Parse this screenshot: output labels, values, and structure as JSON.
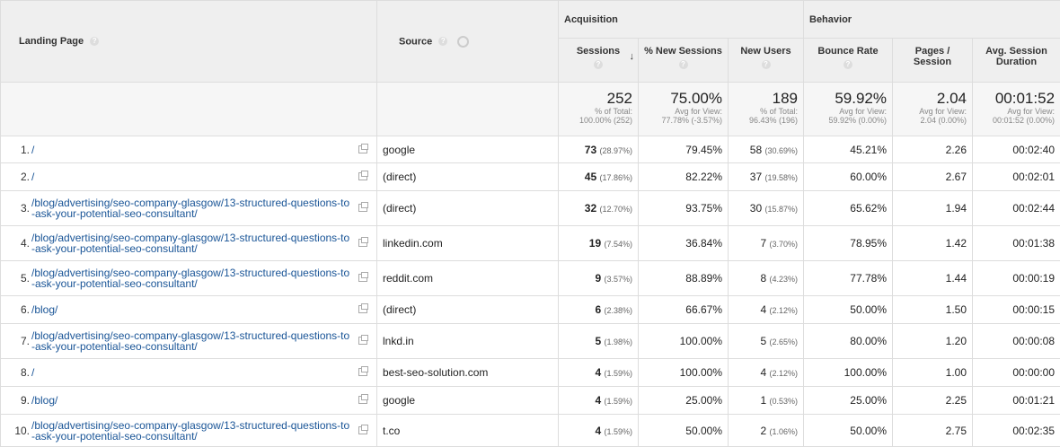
{
  "headers": {
    "landing_page": "Landing Page",
    "source": "Source",
    "acquisition": "Acquisition",
    "behavior": "Behavior",
    "sessions": "Sessions",
    "pct_new_sessions": "% New Sessions",
    "new_users": "New Users",
    "bounce_rate": "Bounce Rate",
    "pages_session_1": "Pages /",
    "pages_session_2": "Session",
    "avg_duration_1": "Avg. Session",
    "avg_duration_2": "Duration",
    "help": "?",
    "sort_arrow": "↓"
  },
  "totals": {
    "sessions": "252",
    "sessions_sub1": "% of Total:",
    "sessions_sub2": "100.00% (252)",
    "pct_new": "75.00%",
    "pct_new_sub1": "Avg for View:",
    "pct_new_sub2": "77.78% (-3.57%)",
    "new_users": "189",
    "new_users_sub1": "% of Total:",
    "new_users_sub2": "96.43% (196)",
    "bounce": "59.92%",
    "bounce_sub1": "Avg for View:",
    "bounce_sub2": "59.92% (0.00%)",
    "pages": "2.04",
    "pages_sub1": "Avg for View:",
    "pages_sub2": "2.04 (0.00%)",
    "duration": "00:01:52",
    "duration_sub1": "Avg for View:",
    "duration_sub2": "00:01:52 (0.00%)"
  },
  "rows": [
    {
      "idx": "1.",
      "page": "/",
      "source": "google",
      "sessions": "73",
      "sessions_pct": "(28.97%)",
      "pct_new": "79.45%",
      "new_users": "58",
      "new_users_pct": "(30.69%)",
      "bounce": "45.21%",
      "pages": "2.26",
      "duration": "00:02:40"
    },
    {
      "idx": "2.",
      "page": "/",
      "source": "(direct)",
      "sessions": "45",
      "sessions_pct": "(17.86%)",
      "pct_new": "82.22%",
      "new_users": "37",
      "new_users_pct": "(19.58%)",
      "bounce": "60.00%",
      "pages": "2.67",
      "duration": "00:02:01"
    },
    {
      "idx": "3.",
      "page": "/blog/advertising/seo-company-glasgow/13-structured-questions-to-ask-your-potential-seo-consultant/",
      "source": "(direct)",
      "sessions": "32",
      "sessions_pct": "(12.70%)",
      "pct_new": "93.75%",
      "new_users": "30",
      "new_users_pct": "(15.87%)",
      "bounce": "65.62%",
      "pages": "1.94",
      "duration": "00:02:44"
    },
    {
      "idx": "4.",
      "page": "/blog/advertising/seo-company-glasgow/13-structured-questions-to-ask-your-potential-seo-consultant/",
      "source": "linkedin.com",
      "sessions": "19",
      "sessions_pct": "(7.54%)",
      "pct_new": "36.84%",
      "new_users": "7",
      "new_users_pct": "(3.70%)",
      "bounce": "78.95%",
      "pages": "1.42",
      "duration": "00:01:38"
    },
    {
      "idx": "5.",
      "page": "/blog/advertising/seo-company-glasgow/13-structured-questions-to-ask-your-potential-seo-consultant/",
      "source": "reddit.com",
      "sessions": "9",
      "sessions_pct": "(3.57%)",
      "pct_new": "88.89%",
      "new_users": "8",
      "new_users_pct": "(4.23%)",
      "bounce": "77.78%",
      "pages": "1.44",
      "duration": "00:00:19"
    },
    {
      "idx": "6.",
      "page": "/blog/",
      "source": "(direct)",
      "sessions": "6",
      "sessions_pct": "(2.38%)",
      "pct_new": "66.67%",
      "new_users": "4",
      "new_users_pct": "(2.12%)",
      "bounce": "50.00%",
      "pages": "1.50",
      "duration": "00:00:15"
    },
    {
      "idx": "7.",
      "page": "/blog/advertising/seo-company-glasgow/13-structured-questions-to-ask-your-potential-seo-consultant/",
      "source": "lnkd.in",
      "sessions": "5",
      "sessions_pct": "(1.98%)",
      "pct_new": "100.00%",
      "new_users": "5",
      "new_users_pct": "(2.65%)",
      "bounce": "80.00%",
      "pages": "1.20",
      "duration": "00:00:08"
    },
    {
      "idx": "8.",
      "page": "/",
      "source": "best-seo-solution.com",
      "sessions": "4",
      "sessions_pct": "(1.59%)",
      "pct_new": "100.00%",
      "new_users": "4",
      "new_users_pct": "(2.12%)",
      "bounce": "100.00%",
      "pages": "1.00",
      "duration": "00:00:00"
    },
    {
      "idx": "9.",
      "page": "/blog/",
      "source": "google",
      "sessions": "4",
      "sessions_pct": "(1.59%)",
      "pct_new": "25.00%",
      "new_users": "1",
      "new_users_pct": "(0.53%)",
      "bounce": "25.00%",
      "pages": "2.25",
      "duration": "00:01:21"
    },
    {
      "idx": "10.",
      "page": "/blog/advertising/seo-company-glasgow/13-structured-questions-to-ask-your-potential-seo-consultant/",
      "source": "t.co",
      "sessions": "4",
      "sessions_pct": "(1.59%)",
      "pct_new": "50.00%",
      "new_users": "2",
      "new_users_pct": "(1.06%)",
      "bounce": "50.00%",
      "pages": "2.75",
      "duration": "00:02:35"
    }
  ]
}
